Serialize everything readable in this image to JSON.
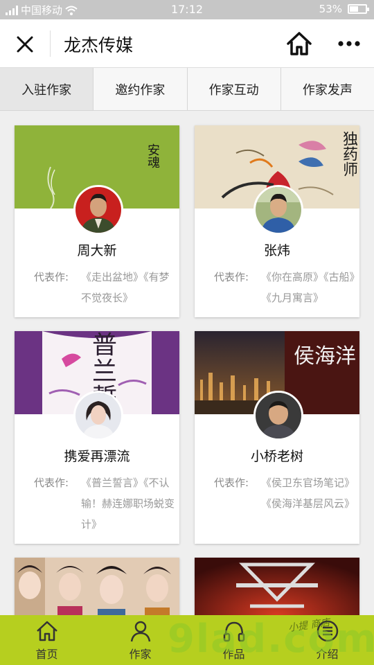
{
  "status_bar": {
    "carrier": "中国移动",
    "time": "17:12",
    "battery": "53%",
    "battery_level": 0.53
  },
  "header": {
    "title": "龙杰传媒"
  },
  "tabs": [
    "入驻作家",
    "邀约作家",
    "作家互动",
    "作家发声"
  ],
  "works_label": "代表作:",
  "authors": [
    {
      "name": "周大新",
      "works": "《走出盆地》《有梦不觉夜长》",
      "cover_text": "安魂"
    },
    {
      "name": "张炜",
      "works": "《你在高原》《古船》《九月寓言》",
      "cover_text": "独药师"
    },
    {
      "name": "携爱再漂流",
      "works": "《普兰誓言》《不认输！赫连娜职场蜕变计》",
      "cover_text": "普兰誓言"
    },
    {
      "name": "小桥老树",
      "works": "《侯卫东官场笔记》《侯海洋基层风云》",
      "cover_text": "侯海洋"
    }
  ],
  "bottom_nav": [
    {
      "label": "首页",
      "icon": "home-icon"
    },
    {
      "label": "作家",
      "icon": "user-icon"
    },
    {
      "label": "作品",
      "icon": "headphones-icon"
    },
    {
      "label": "介绍",
      "icon": "list-icon"
    }
  ],
  "watermark": {
    "text": "9lad.com",
    "subtext": "小提 商店"
  },
  "colors": {
    "nav_bg": "#b6cf1f",
    "status_bg": "#c6c6c6"
  }
}
